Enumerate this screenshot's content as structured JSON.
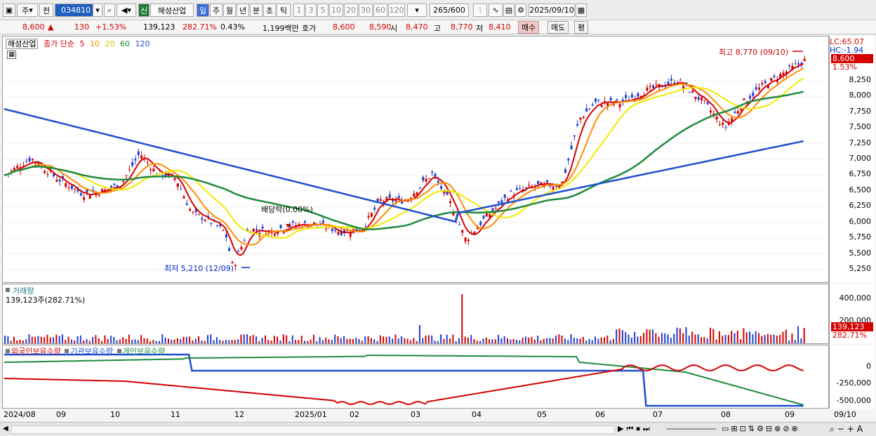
{
  "toolbar": {
    "market_1": "주",
    "market_2": "전",
    "code": "034810",
    "sin": "신",
    "name": "해성산업",
    "periods": [
      "일",
      "주",
      "월",
      "년",
      "분",
      "초",
      "틱"
    ],
    "active_period": "일",
    "intervals": [
      "1",
      "3",
      "5",
      "10",
      "20",
      "30",
      "60",
      "120"
    ],
    "count": "265",
    "total": "/600",
    "date": "2025/09/10"
  },
  "quote": {
    "price": "8,600",
    "arrow": "▲",
    "change": "130",
    "change_pct": "+1.53%",
    "volume": "139,123",
    "vol_ratio": "282.71%",
    "turnover": "0.43%",
    "amount": "1,199백만",
    "hoga_label": "호가",
    "ask": "8,600",
    "bid": "8,590",
    "open_label": "시",
    "open": "8,470",
    "high_label": "고",
    "high": "8,770",
    "low_label": "저",
    "low": "8,410",
    "buy": "매수",
    "sell": "매도",
    "eval": "평"
  },
  "price_panel": {
    "stock_tab": "해성산업",
    "ma_title": "종가 단순",
    "ma_periods": [
      "5",
      "10",
      "20",
      "60",
      "120"
    ],
    "ma_colors": [
      "#d40000",
      "#ff8c00",
      "#e8e800",
      "#1e8a3c",
      "#1e4fd0"
    ],
    "lc": "LC:65.07",
    "hc": "HC:-1.94",
    "last": "8,600",
    "last_pct": "1.53%",
    "high_note": "최고 8,770 (09/10)",
    "low_note": "최저 5,210 (12/09)",
    "dividend_note": "배당락(0.00%)",
    "y_ticks": [
      "8,250",
      "8,000",
      "7,750",
      "7,500",
      "7,250",
      "7,000",
      "6,750",
      "6,500",
      "6,250",
      "6,000",
      "5,750",
      "5,500",
      "5,250"
    ]
  },
  "volume_panel": {
    "title": "거래량",
    "value": "139,123주(282.71%)",
    "y_ticks": [
      "400,000",
      "200,000"
    ],
    "last": "139,123",
    "last_pct": "282.71%"
  },
  "holdings_panel": {
    "legend": [
      "외국인보유수량",
      "기관보유수량",
      "개인보유수량"
    ],
    "y_ticks": [
      "0",
      "-250,000",
      "-500,000"
    ]
  },
  "x_axis": [
    "2024/08",
    "09",
    "10",
    "11",
    "12",
    "2025/01",
    "02",
    "03",
    "04",
    "05",
    "06",
    "07",
    "08",
    "09",
    "09/10"
  ],
  "chart_data": {
    "type": "candlestick",
    "last_close": 8600,
    "period_high": 8770,
    "period_low": 5210,
    "ylim": [
      5050,
      8950
    ]
  }
}
